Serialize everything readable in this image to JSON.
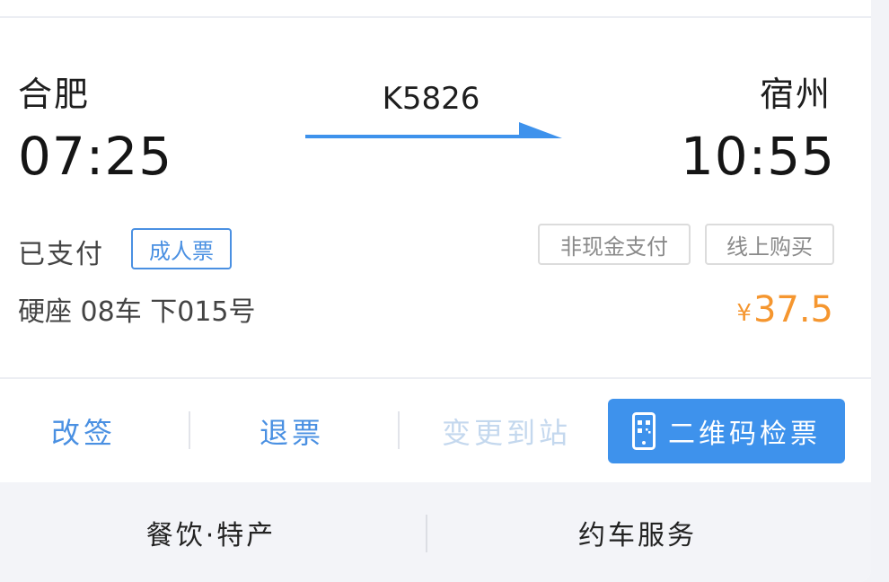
{
  "trip": {
    "from_station": "合肥",
    "to_station": "宿州",
    "depart_time": "07:25",
    "arrive_time": "10:55",
    "train_no": "K5826"
  },
  "ticket": {
    "status": "已支付",
    "type_badge": "成人票",
    "payment_badge": "非现金支付",
    "purchase_badge": "线上购买",
    "seat": "硬座 08车 下015号",
    "price_symbol": "¥",
    "price": "37.5"
  },
  "actions": {
    "change": "改签",
    "refund": "退票",
    "change_station": "变更到站",
    "qr_check": "二维码检票",
    "qr_icon": "qr-phone-icon"
  },
  "footer": {
    "dining": "餐饮·特产",
    "ride": "约车服务"
  },
  "colors": {
    "accent": "#3e92ec",
    "link": "#4a90e2",
    "price": "#f5962f",
    "disabled": "#c4d8ee"
  }
}
